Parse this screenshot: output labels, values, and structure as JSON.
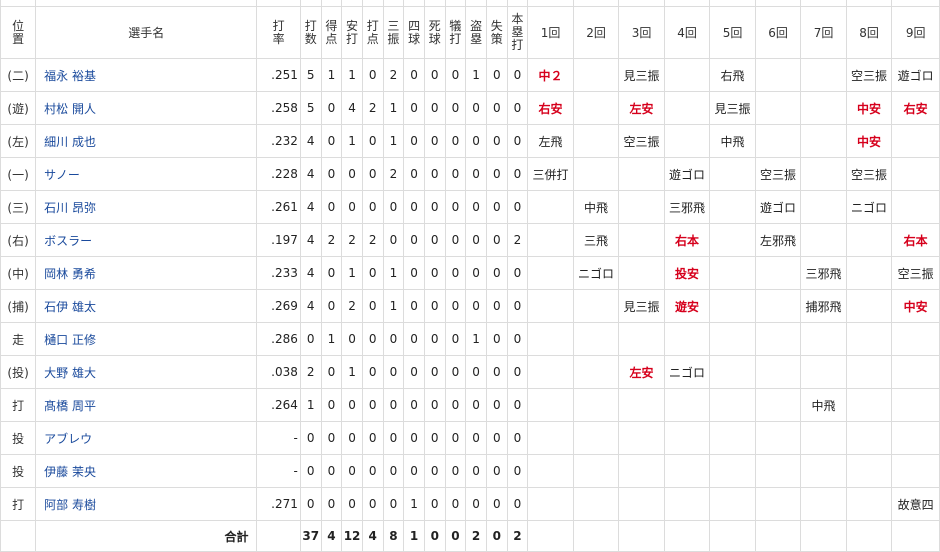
{
  "headers": {
    "position": [
      "位",
      "置"
    ],
    "player": "選手名",
    "avg": [
      "打",
      "率"
    ],
    "stats": [
      [
        "打",
        "数"
      ],
      [
        "得",
        "点"
      ],
      [
        "安",
        "打"
      ],
      [
        "打",
        "点"
      ],
      [
        "三",
        "振"
      ],
      [
        "四",
        "球"
      ],
      [
        "死",
        "球"
      ],
      [
        "犠",
        "打"
      ],
      [
        "盗",
        "塁"
      ],
      [
        "失",
        "策"
      ],
      [
        "本",
        "塁",
        "打"
      ]
    ],
    "innings": [
      "1回",
      "2回",
      "3回",
      "4回",
      "5回",
      "6回",
      "7回",
      "8回",
      "9回"
    ]
  },
  "players": [
    {
      "pos": "(二)",
      "name": "福永 裕基",
      "avg": ".251",
      "stats": [
        "5",
        "1",
        "1",
        "0",
        "2",
        "0",
        "0",
        "0",
        "1",
        "0",
        "0"
      ],
      "innings": [
        {
          "t": "中２",
          "hit": true
        },
        {
          "t": ""
        },
        {
          "t": "見三振"
        },
        {
          "t": ""
        },
        {
          "t": "右飛"
        },
        {
          "t": ""
        },
        {
          "t": ""
        },
        {
          "t": "空三振"
        },
        {
          "t": "遊ゴロ"
        }
      ]
    },
    {
      "pos": "(遊)",
      "name": "村松 開人",
      "avg": ".258",
      "stats": [
        "5",
        "0",
        "4",
        "2",
        "1",
        "0",
        "0",
        "0",
        "0",
        "0",
        "0"
      ],
      "innings": [
        {
          "t": "右安",
          "hit": true
        },
        {
          "t": ""
        },
        {
          "t": "左安",
          "hit": true
        },
        {
          "t": ""
        },
        {
          "t": "見三振"
        },
        {
          "t": ""
        },
        {
          "t": ""
        },
        {
          "t": "中安",
          "hit": true
        },
        {
          "t": "右安",
          "hit": true
        }
      ]
    },
    {
      "pos": "(左)",
      "name": "細川 成也",
      "avg": ".232",
      "stats": [
        "4",
        "0",
        "1",
        "0",
        "1",
        "0",
        "0",
        "0",
        "0",
        "0",
        "0"
      ],
      "innings": [
        {
          "t": "左飛"
        },
        {
          "t": ""
        },
        {
          "t": "空三振"
        },
        {
          "t": ""
        },
        {
          "t": "中飛"
        },
        {
          "t": ""
        },
        {
          "t": ""
        },
        {
          "t": "中安",
          "hit": true
        },
        {
          "t": ""
        }
      ]
    },
    {
      "pos": "(一)",
      "name": "サノー",
      "avg": ".228",
      "stats": [
        "4",
        "0",
        "0",
        "0",
        "2",
        "0",
        "0",
        "0",
        "0",
        "0",
        "0"
      ],
      "innings": [
        {
          "t": "三併打"
        },
        {
          "t": ""
        },
        {
          "t": ""
        },
        {
          "t": "遊ゴロ"
        },
        {
          "t": ""
        },
        {
          "t": "空三振"
        },
        {
          "t": ""
        },
        {
          "t": "空三振"
        },
        {
          "t": ""
        }
      ]
    },
    {
      "pos": "(三)",
      "name": "石川 昂弥",
      "avg": ".261",
      "stats": [
        "4",
        "0",
        "0",
        "0",
        "0",
        "0",
        "0",
        "0",
        "0",
        "0",
        "0"
      ],
      "innings": [
        {
          "t": ""
        },
        {
          "t": "中飛"
        },
        {
          "t": ""
        },
        {
          "t": "三邪飛"
        },
        {
          "t": ""
        },
        {
          "t": "遊ゴロ"
        },
        {
          "t": ""
        },
        {
          "t": "ニゴロ"
        },
        {
          "t": ""
        }
      ]
    },
    {
      "pos": "(右)",
      "name": "ボスラー",
      "avg": ".197",
      "stats": [
        "4",
        "2",
        "2",
        "2",
        "0",
        "0",
        "0",
        "0",
        "0",
        "0",
        "2"
      ],
      "innings": [
        {
          "t": ""
        },
        {
          "t": "三飛"
        },
        {
          "t": ""
        },
        {
          "t": "右本",
          "hit": true
        },
        {
          "t": ""
        },
        {
          "t": "左邪飛"
        },
        {
          "t": ""
        },
        {
          "t": ""
        },
        {
          "t": "右本",
          "hit": true
        }
      ]
    },
    {
      "pos": "(中)",
      "name": "岡林 勇希",
      "avg": ".233",
      "stats": [
        "4",
        "0",
        "1",
        "0",
        "1",
        "0",
        "0",
        "0",
        "0",
        "0",
        "0"
      ],
      "innings": [
        {
          "t": ""
        },
        {
          "t": "ニゴロ"
        },
        {
          "t": ""
        },
        {
          "t": "投安",
          "hit": true
        },
        {
          "t": ""
        },
        {
          "t": ""
        },
        {
          "t": "三邪飛"
        },
        {
          "t": ""
        },
        {
          "t": "空三振"
        }
      ]
    },
    {
      "pos": "(捕)",
      "name": "石伊 雄太",
      "avg": ".269",
      "stats": [
        "4",
        "0",
        "2",
        "0",
        "1",
        "0",
        "0",
        "0",
        "0",
        "0",
        "0"
      ],
      "innings": [
        {
          "t": ""
        },
        {
          "t": ""
        },
        {
          "t": "見三振"
        },
        {
          "t": "遊安",
          "hit": true
        },
        {
          "t": ""
        },
        {
          "t": ""
        },
        {
          "t": "捕邪飛"
        },
        {
          "t": ""
        },
        {
          "t": "中安",
          "hit": true
        }
      ]
    },
    {
      "pos": "走",
      "name": "樋口 正修",
      "avg": ".286",
      "stats": [
        "0",
        "1",
        "0",
        "0",
        "0",
        "0",
        "0",
        "0",
        "1",
        "0",
        "0"
      ],
      "innings": [
        {
          "t": ""
        },
        {
          "t": ""
        },
        {
          "t": ""
        },
        {
          "t": ""
        },
        {
          "t": ""
        },
        {
          "t": ""
        },
        {
          "t": ""
        },
        {
          "t": ""
        },
        {
          "t": ""
        }
      ]
    },
    {
      "pos": "(投)",
      "name": "大野 雄大",
      "avg": ".038",
      "stats": [
        "2",
        "0",
        "1",
        "0",
        "0",
        "0",
        "0",
        "0",
        "0",
        "0",
        "0"
      ],
      "innings": [
        {
          "t": ""
        },
        {
          "t": ""
        },
        {
          "t": "左安",
          "hit": true
        },
        {
          "t": "ニゴロ"
        },
        {
          "t": ""
        },
        {
          "t": ""
        },
        {
          "t": ""
        },
        {
          "t": ""
        },
        {
          "t": ""
        }
      ]
    },
    {
      "pos": "打",
      "name": "髙橋 周平",
      "avg": ".264",
      "stats": [
        "1",
        "0",
        "0",
        "0",
        "0",
        "0",
        "0",
        "0",
        "0",
        "0",
        "0"
      ],
      "innings": [
        {
          "t": ""
        },
        {
          "t": ""
        },
        {
          "t": ""
        },
        {
          "t": ""
        },
        {
          "t": ""
        },
        {
          "t": ""
        },
        {
          "t": "中飛"
        },
        {
          "t": ""
        },
        {
          "t": ""
        }
      ]
    },
    {
      "pos": "投",
      "name": "アブレウ",
      "avg": "-",
      "stats": [
        "0",
        "0",
        "0",
        "0",
        "0",
        "0",
        "0",
        "0",
        "0",
        "0",
        "0"
      ],
      "innings": [
        {
          "t": ""
        },
        {
          "t": ""
        },
        {
          "t": ""
        },
        {
          "t": ""
        },
        {
          "t": ""
        },
        {
          "t": ""
        },
        {
          "t": ""
        },
        {
          "t": ""
        },
        {
          "t": ""
        }
      ]
    },
    {
      "pos": "投",
      "name": "伊藤 茉央",
      "avg": "-",
      "stats": [
        "0",
        "0",
        "0",
        "0",
        "0",
        "0",
        "0",
        "0",
        "0",
        "0",
        "0"
      ],
      "innings": [
        {
          "t": ""
        },
        {
          "t": ""
        },
        {
          "t": ""
        },
        {
          "t": ""
        },
        {
          "t": ""
        },
        {
          "t": ""
        },
        {
          "t": ""
        },
        {
          "t": ""
        },
        {
          "t": ""
        }
      ]
    },
    {
      "pos": "打",
      "name": "阿部 寿樹",
      "avg": ".271",
      "stats": [
        "0",
        "0",
        "0",
        "0",
        "0",
        "1",
        "0",
        "0",
        "0",
        "0",
        "0"
      ],
      "innings": [
        {
          "t": ""
        },
        {
          "t": ""
        },
        {
          "t": ""
        },
        {
          "t": ""
        },
        {
          "t": ""
        },
        {
          "t": ""
        },
        {
          "t": ""
        },
        {
          "t": ""
        },
        {
          "t": "故意四"
        }
      ]
    }
  ],
  "total": {
    "label": "合計",
    "stats": [
      "37",
      "4",
      "12",
      "4",
      "8",
      "1",
      "0",
      "0",
      "2",
      "0",
      "2"
    ]
  },
  "colors": {
    "hit": "#d6001c",
    "name_link": "#1a4a9c",
    "border": "#dcdcdc"
  }
}
